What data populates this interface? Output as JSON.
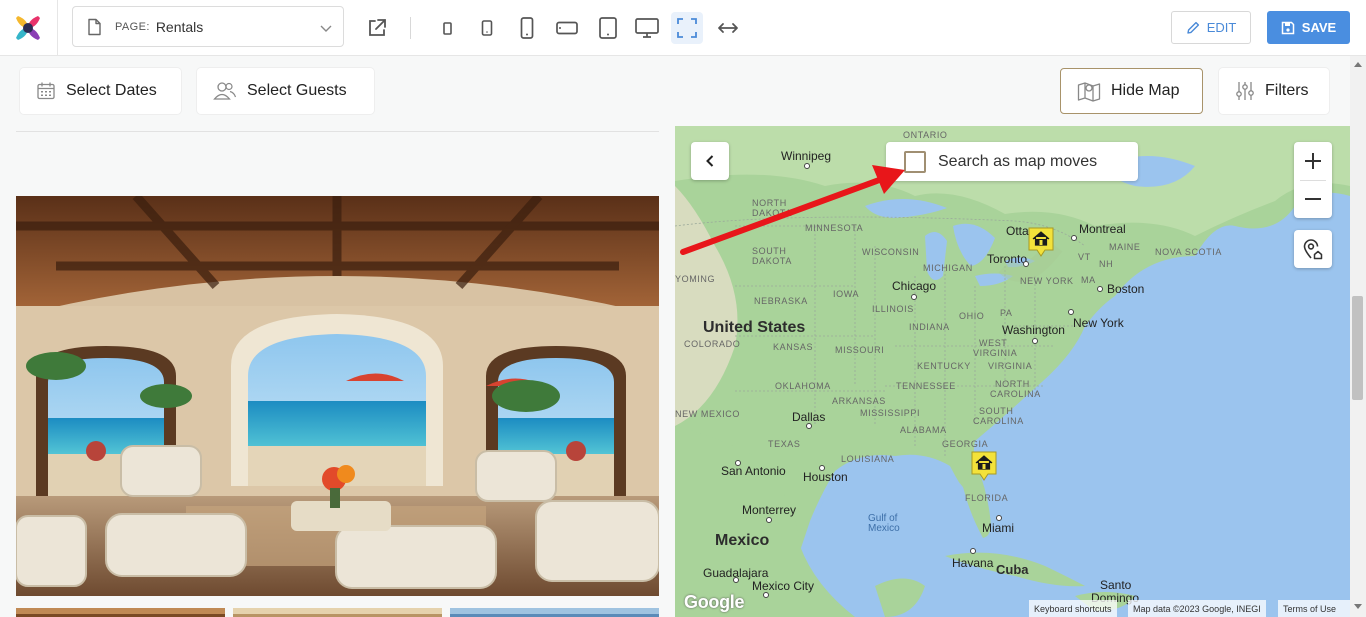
{
  "toolbar": {
    "page_label": "PAGE:",
    "page_value": "Rentals",
    "edit_label": "EDIT",
    "save_label": "SAVE",
    "accent_color": "#4a8ee0"
  },
  "filters": {
    "select_dates": "Select Dates",
    "select_guests": "Select Guests",
    "hide_map": "Hide Map",
    "filters": "Filters"
  },
  "map": {
    "search_as_map_moves": "Search as map moves",
    "search_checked": false,
    "labels": {
      "ontario": "ONTARIO",
      "winnipeg": "Winnipeg",
      "north_dakota_1": "NORTH",
      "north_dakota_2": "DAKOTA",
      "minnesota": "MINNESOTA",
      "wisconsin": "WISCONSIN",
      "south_dakota_1": "SOUTH",
      "south_dakota_2": "DAKOTA",
      "michigan": "MICHIGAN",
      "ottawa": "Otta",
      "montreal": "Montreal",
      "maine": "MAINE",
      "vt": "VT",
      "nh": "NH",
      "nova_scotia": "NOVA SCOTIA",
      "toronto": "Toronto",
      "new_york_state": "NEW YORK",
      "ma": "MA",
      "boston": "Boston",
      "wyoming": "YOMING",
      "nebraska": "NEBRASKA",
      "iowa": "IOWA",
      "chicago": "Chicago",
      "illinois": "ILLINOIS",
      "ohio": "OHIO",
      "pa": "PA",
      "indiana": "INDIANA",
      "united_states": "United States",
      "colorado": "COLORADO",
      "kansas": "KANSAS",
      "missouri": "MISSOURI",
      "washington": "Washington",
      "new_york_city": "New York",
      "west_virginia_1": "WEST",
      "virginia_1": "VIRGINIA",
      "kentucky": "KENTUCKY",
      "virginia": "VIRGINIA",
      "oklahoma": "OKLAHOMA",
      "tennessee": "TENNESSEE",
      "north_carolina_1": "NORTH",
      "carolina_1": "CAROLINA",
      "arkansas": "ARKANSAS",
      "new_mexico": "NEW MEXICO",
      "dallas": "Dallas",
      "mississippi": "MISSISSIPPI",
      "south_carolina_1": "SOUTH",
      "carolina_2": "CAROLINA",
      "alabama": "ALABAMA",
      "texas": "TEXAS",
      "georgia": "GEORGIA",
      "louisiana": "LOUISIANA",
      "san_antonio": "San Antonio",
      "houston": "Houston",
      "florida": "FLORIDA",
      "monterrey": "Monterrey",
      "gulf_1": "Gulf of",
      "gulf_2": "Mexico",
      "miami": "Miami",
      "mexico": "Mexico",
      "havana": "Havana",
      "guadalajara": "Guadalajara",
      "cuba": "Cuba",
      "mexico_city": "Mexico City",
      "santo_domingo_1": "Santo",
      "santo_domingo_2": "Domingo"
    },
    "google": "Google",
    "keyboard_shortcuts": "Keyboard shortcuts",
    "map_data": "Map data ©2023 Google, INEGI",
    "terms": "Terms of Use"
  }
}
